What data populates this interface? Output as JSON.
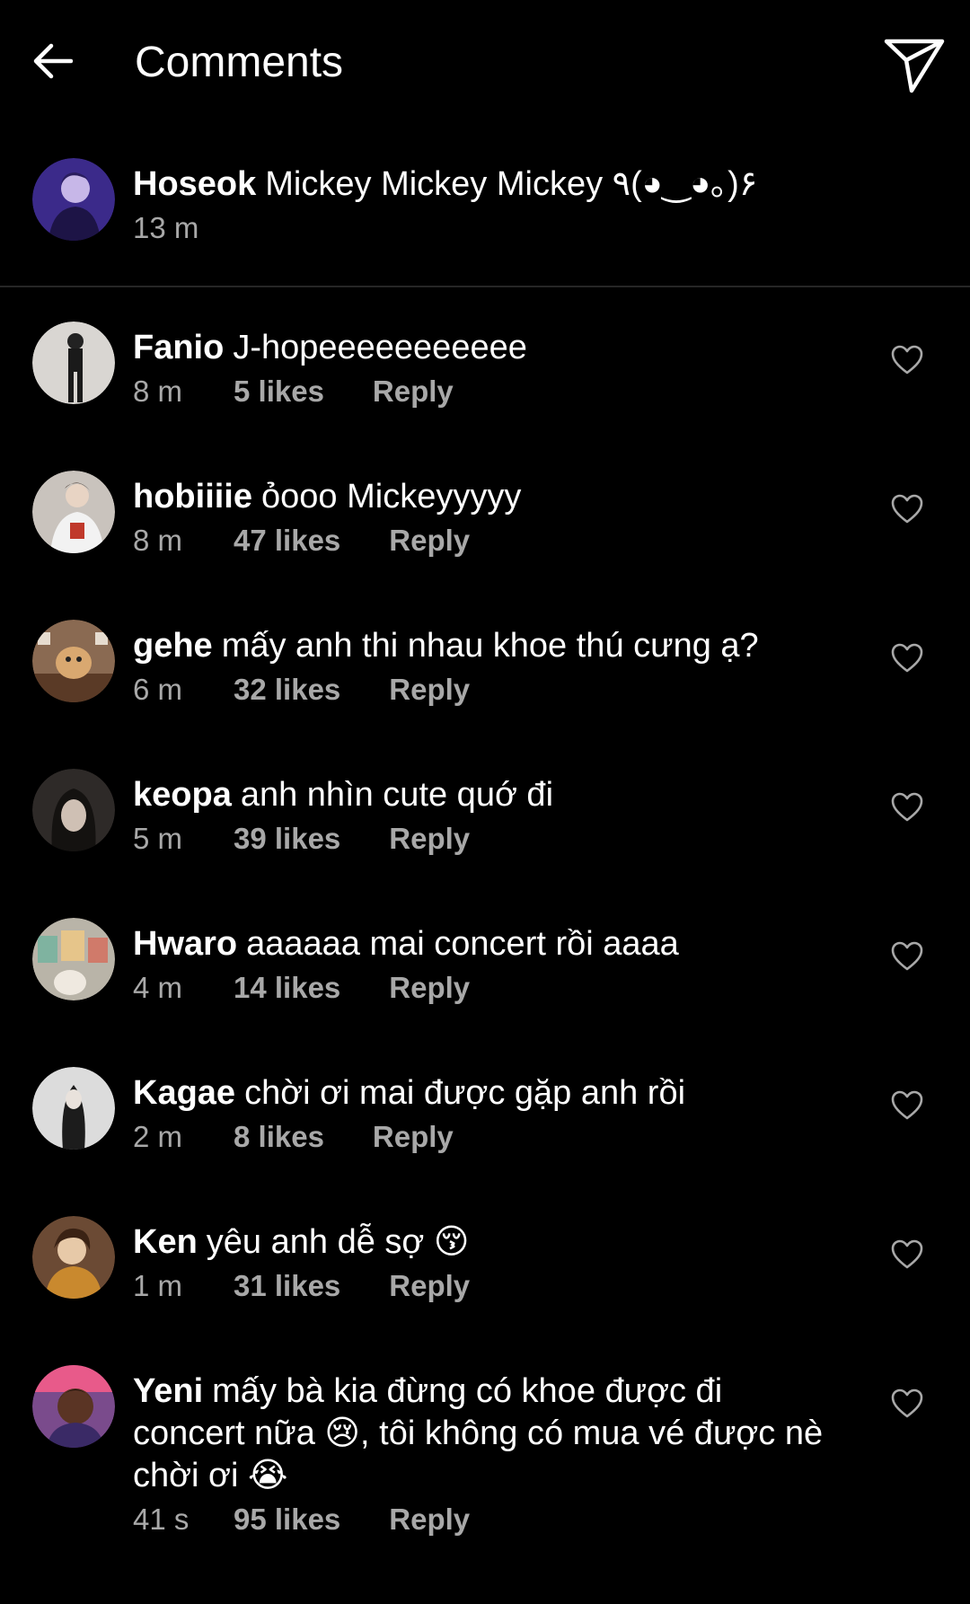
{
  "header": {
    "title": "Comments"
  },
  "caption": {
    "username": "Hoseok",
    "text": "Mickey Mickey Mickey ٩(◕‿◕｡)۶",
    "time": "13 m",
    "avatar_color": "#3b2a8a"
  },
  "comments": [
    {
      "username": "Fanio",
      "text": "J-hopeeeeeeeeeee",
      "time": "8 m",
      "likes": "5 likes",
      "reply": "Reply",
      "avatar_color": "#d9d6d2"
    },
    {
      "username": "hobiiiie",
      "text": "ỏooo Mickeyyyyy",
      "time": "8 m",
      "likes": "47 likes",
      "reply": "Reply",
      "avatar_color": "#c9c3bd"
    },
    {
      "username": "gehe",
      "text": "mấy anh thi nhau khoe thú cưng ạ?",
      "time": "6 m",
      "likes": "32 likes",
      "reply": "Reply",
      "avatar_color": "#8a6a52"
    },
    {
      "username": "keopa",
      "text": "anh nhìn cute quớ đi",
      "time": "5 m",
      "likes": "39 likes",
      "reply": "Reply",
      "avatar_color": "#2e2a28"
    },
    {
      "username": "Hwaro",
      "text": "aaaaaa mai concert rồi aaaa",
      "time": "4 m",
      "likes": "14 likes",
      "reply": "Reply",
      "avatar_color": "#b9b4a8"
    },
    {
      "username": "Kagae",
      "text": "chời ơi mai được gặp anh rồi",
      "time": "2 m",
      "likes": "8 likes",
      "reply": "Reply",
      "avatar_color": "#dcdcdc"
    },
    {
      "username": "Ken",
      "text": "yêu anh dễ sợ 😚",
      "time": "1 m",
      "likes": "31 likes",
      "reply": "Reply",
      "avatar_color": "#6b4a34"
    },
    {
      "username": "Yeni",
      "text": "mấy bà kia đừng có khoe được đi concert nữa 😢, tôi không có mua vé được nè chời ơi 😭",
      "time": "41 s",
      "likes": "95 likes",
      "reply": "Reply",
      "avatar_color": "#7a4b8c"
    }
  ],
  "icons": {
    "back": "arrow-left-icon",
    "send": "paper-plane-icon",
    "like": "heart-outline-icon"
  }
}
